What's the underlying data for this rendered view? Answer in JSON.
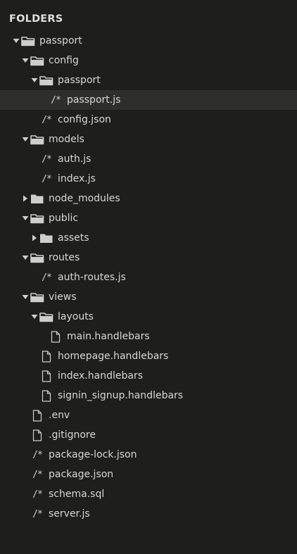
{
  "sidebar": {
    "header": "FOLDERS",
    "items": [
      {
        "label": "passport",
        "kind": "folder",
        "state": "expanded",
        "depth": 0,
        "icon": "folder-open-icon"
      },
      {
        "label": "config",
        "kind": "folder",
        "state": "expanded",
        "depth": 1,
        "icon": "folder-open-icon"
      },
      {
        "label": "passport",
        "kind": "folder",
        "state": "expanded",
        "depth": 2,
        "icon": "folder-open-icon"
      },
      {
        "label": "passport.js",
        "kind": "code",
        "depth": 3,
        "icon": "code-file-icon",
        "glyph": "/*",
        "selected": true
      },
      {
        "label": "config.json",
        "kind": "code",
        "depth": 2,
        "icon": "code-file-icon",
        "glyph": "/*"
      },
      {
        "label": "models",
        "kind": "folder",
        "state": "expanded",
        "depth": 1,
        "icon": "folder-open-icon"
      },
      {
        "label": "auth.js",
        "kind": "code",
        "depth": 2,
        "icon": "code-file-icon",
        "glyph": "/*"
      },
      {
        "label": "index.js",
        "kind": "code",
        "depth": 2,
        "icon": "code-file-icon",
        "glyph": "/*"
      },
      {
        "label": "node_modules",
        "kind": "folder",
        "state": "collapsed",
        "depth": 1,
        "icon": "folder-closed-icon"
      },
      {
        "label": "public",
        "kind": "folder",
        "state": "expanded",
        "depth": 1,
        "icon": "folder-open-icon"
      },
      {
        "label": "assets",
        "kind": "folder",
        "state": "collapsed",
        "depth": 2,
        "icon": "folder-closed-icon"
      },
      {
        "label": "routes",
        "kind": "folder",
        "state": "expanded",
        "depth": 1,
        "icon": "folder-open-icon"
      },
      {
        "label": "auth-routes.js",
        "kind": "code",
        "depth": 2,
        "icon": "code-file-icon",
        "glyph": "/*"
      },
      {
        "label": "views",
        "kind": "folder",
        "state": "expanded",
        "depth": 1,
        "icon": "folder-open-icon"
      },
      {
        "label": "layouts",
        "kind": "folder",
        "state": "expanded",
        "depth": 2,
        "icon": "folder-open-icon"
      },
      {
        "label": "main.handlebars",
        "kind": "file",
        "depth": 3,
        "icon": "file-icon"
      },
      {
        "label": "homepage.handlebars",
        "kind": "file",
        "depth": 2,
        "icon": "file-icon"
      },
      {
        "label": "index.handlebars",
        "kind": "file",
        "depth": 2,
        "icon": "file-icon"
      },
      {
        "label": "signin_signup.handlebars",
        "kind": "file",
        "depth": 2,
        "icon": "file-icon"
      },
      {
        "label": ".env",
        "kind": "file",
        "depth": 1,
        "icon": "file-icon"
      },
      {
        "label": ".gitignore",
        "kind": "file",
        "depth": 1,
        "icon": "file-icon"
      },
      {
        "label": "package-lock.json",
        "kind": "code",
        "depth": 1,
        "icon": "code-file-icon",
        "glyph": "/*"
      },
      {
        "label": "package.json",
        "kind": "code",
        "depth": 1,
        "icon": "code-file-icon",
        "glyph": "/*"
      },
      {
        "label": "schema.sql",
        "kind": "code",
        "depth": 1,
        "icon": "code-file-icon",
        "glyph": "/*"
      },
      {
        "label": "server.js",
        "kind": "code",
        "depth": 1,
        "icon": "code-file-icon",
        "glyph": "/*"
      }
    ]
  },
  "colors": {
    "background": "#1e1e1b",
    "selected_row": "#2e2f2b",
    "text": "#d7d7d2",
    "icon": "#cfcfca"
  }
}
